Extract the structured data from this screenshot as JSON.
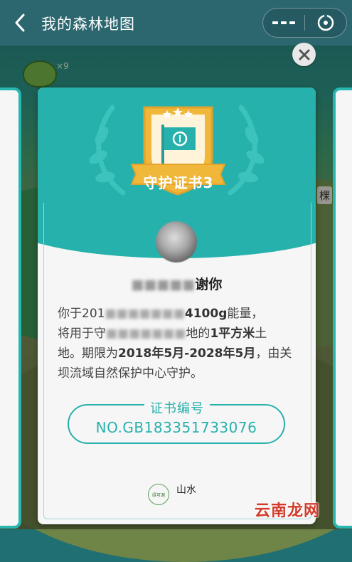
{
  "navbar": {
    "title": "我的森林地图"
  },
  "certificate": {
    "badge_title": "守护证书3",
    "thanks_visible": "谢你",
    "thanks_obscured": "■■■■■",
    "body": {
      "line1_prefix": "你于201",
      "line1_obscured": "■■■■■■■",
      "line1_amount": "4100g",
      "line1_suffix": "能量，",
      "line2_prefix": "将用于守",
      "line2_obscured": "■■■■■■■",
      "line2_suffix": "地的",
      "line2_area": "1平方米",
      "line2_end": "土",
      "line3_prefix": "地。期限为",
      "line3_period": "2018年5月-2028年5月",
      "line3_suffix": "，由关",
      "line4": "坝流域自然保护中心守护。"
    },
    "cert_number_label": "证书编号",
    "cert_number": "NO.GB183351733076",
    "logo_left": "绿可源",
    "logo_right": "山水"
  },
  "background": {
    "bubble_count": "×9",
    "side_label": "棵"
  },
  "watermark": "云南龙网",
  "colors": {
    "teal": "#27b1ad",
    "navbar": "#2c6770",
    "badge_gold": "#f0b73a"
  },
  "icons": {
    "back": "chevron-left-icon",
    "more": "more-dots-icon",
    "target": "target-icon",
    "close": "close-icon",
    "shield_badge": "shield-flag-badge-icon"
  }
}
